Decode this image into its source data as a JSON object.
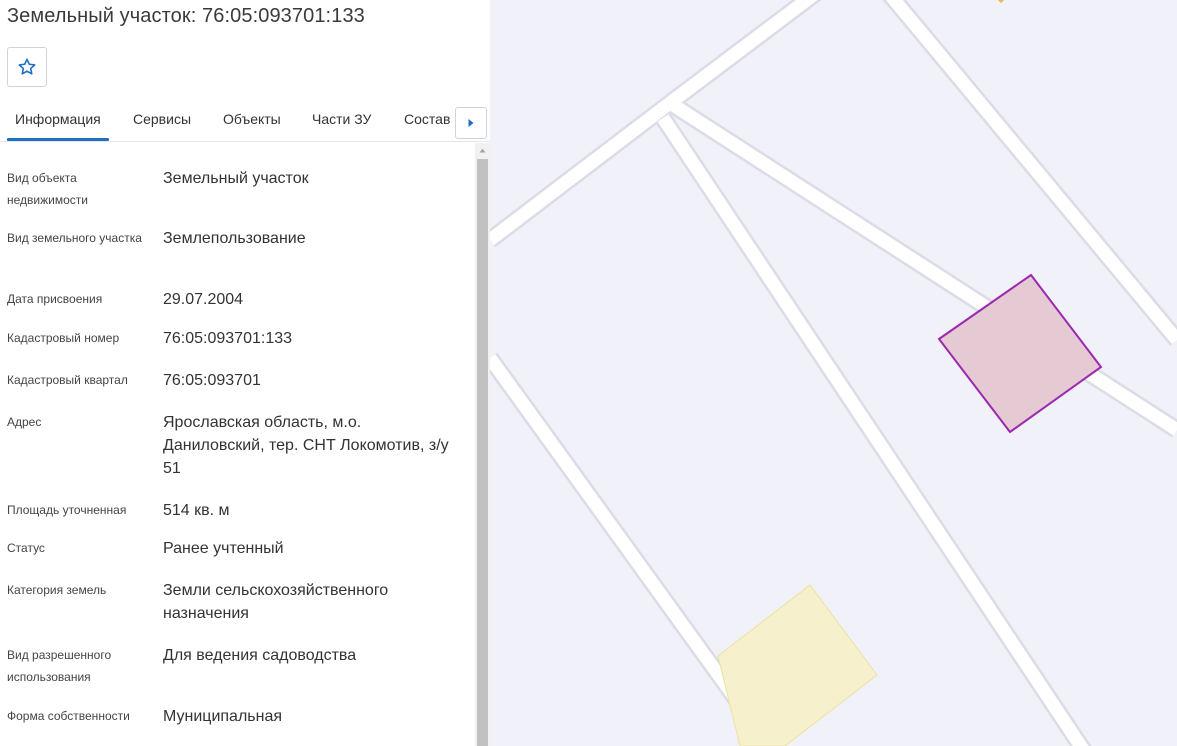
{
  "header": {
    "title": "Земельный участок: 76:05:093701:133"
  },
  "tabs": [
    {
      "label": "Информация",
      "active": true
    },
    {
      "label": "Сервисы",
      "active": false
    },
    {
      "label": "Объекты",
      "active": false
    },
    {
      "label": "Части ЗУ",
      "active": false
    },
    {
      "label": "Состав",
      "active": false
    }
  ],
  "properties": [
    {
      "label": "Вид объекта недвижимости",
      "value": "Земельный участок"
    },
    {
      "label": "Вид земельного участка",
      "value": "Землепользование"
    },
    {
      "label": "Дата присвоения",
      "value": "29.07.2004"
    },
    {
      "label": "Кадастровый номер",
      "value": "76:05:093701:133"
    },
    {
      "label": "Кадастровый квартал",
      "value": "76:05:093701"
    },
    {
      "label": "Адрес",
      "value": "Ярославская область, м.о. Даниловский, тер. СНТ Локомотив, з/у 51"
    },
    {
      "label": "Площадь уточненная",
      "value": "514 кв. м"
    },
    {
      "label": "Статус",
      "value": "Ранее учтенный"
    },
    {
      "label": "Категория земель",
      "value": "Земли сельскохозяйственного назначения"
    },
    {
      "label": "Вид разрешенного использования",
      "value": "Для ведения садоводства"
    },
    {
      "label": "Форма собственности",
      "value": "Муниципальная"
    }
  ],
  "icons": {
    "favorite": "star-outline-icon",
    "tabs_next": "caret-right-icon",
    "scroll_up": "caret-up-icon"
  },
  "colors": {
    "accent": "#1f6fc4",
    "map_background": "#f1f1f9",
    "road": "#ffffff",
    "selected_parcel_fill": "#e5c9d3",
    "selected_parcel_stroke": "#9c27b0",
    "other_parcel_fill": "#f6f0cc",
    "other_parcel_stroke": "#ece2a2"
  }
}
